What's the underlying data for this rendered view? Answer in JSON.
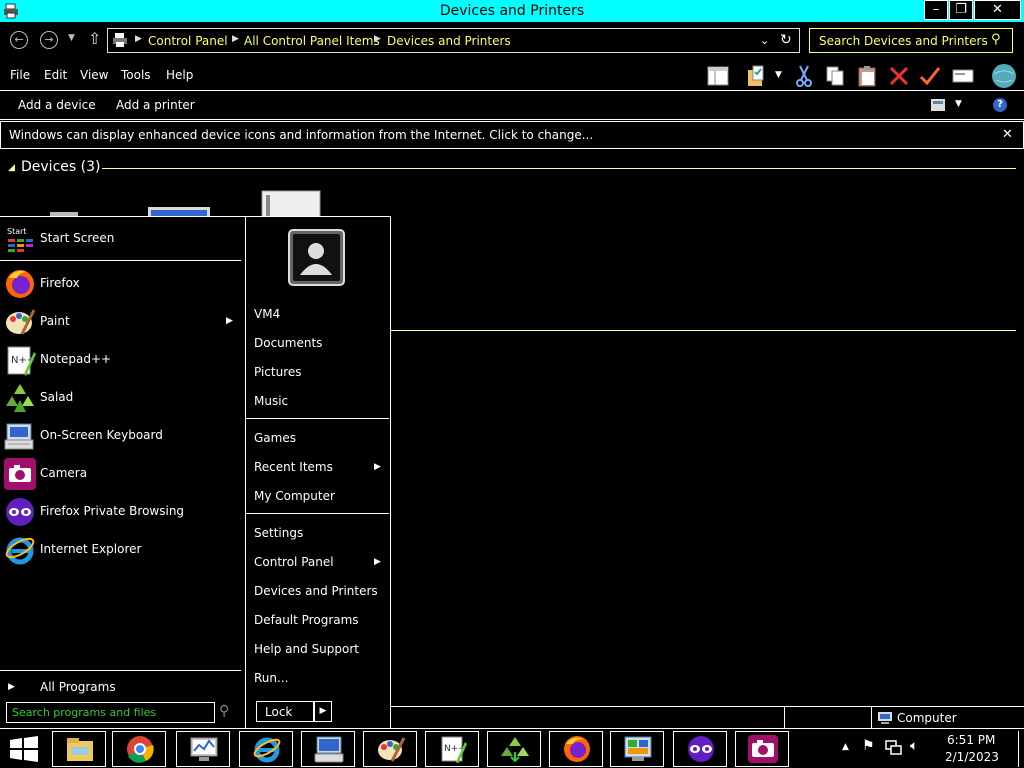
{
  "window": {
    "title": "Devices and Printers",
    "minimize_label": "–",
    "maximize_label": "❐",
    "close_label": "✕"
  },
  "address": {
    "crumbs": [
      "Control Panel",
      "All Control Panel Items",
      "Devices and Printers"
    ],
    "search_placeholder": "Search Devices and Printers"
  },
  "menubar": {
    "items": [
      "File",
      "Edit",
      "View",
      "Tools",
      "Help"
    ]
  },
  "commandbar": {
    "add_device": "Add a device",
    "add_printer": "Add a printer"
  },
  "infobar": {
    "text": "Windows can display enhanced device icons and information from the Internet. Click to change...",
    "close_label": "✕"
  },
  "groups": {
    "devices_header": "Devices (3)"
  },
  "startmenu": {
    "apps": [
      {
        "label": "Start Screen",
        "icon": "start-screen-icon"
      },
      {
        "label": "Firefox",
        "icon": "firefox-icon"
      },
      {
        "label": "Paint",
        "icon": "paint-icon"
      },
      {
        "label": "Notepad++",
        "icon": "notepad-plus-icon"
      },
      {
        "label": "Salad",
        "icon": "salad-icon"
      },
      {
        "label": "On-Screen Keyboard",
        "icon": "keyboard-icon"
      },
      {
        "label": "Camera",
        "icon": "camera-icon"
      },
      {
        "label": "Firefox Private Browsing",
        "icon": "private-browsing-icon"
      },
      {
        "label": "Internet Explorer",
        "icon": "ie-icon"
      }
    ],
    "start_icon_text": "Start",
    "all_programs": "All Programs",
    "search_placeholder": "Search programs and files",
    "right_items": {
      "user": "VM4",
      "documents": "Documents",
      "pictures": "Pictures",
      "music": "Music",
      "games": "Games",
      "recent_items": "Recent Items",
      "my_computer": "My Computer",
      "settings": "Settings",
      "control_panel": "Control Panel",
      "devices_printers": "Devices and Printers",
      "default_programs": "Default Programs",
      "help_support": "Help and Support",
      "run": "Run..."
    },
    "lock_label": "Lock"
  },
  "statusbar": {
    "computer_label": "Computer"
  },
  "taskbar": {
    "time": "6:51 PM",
    "date": "2/1/2023",
    "buttons": [
      "file-explorer-icon",
      "chrome-icon",
      "performance-monitor-icon",
      "ie-icon",
      "computer-icon",
      "paint-icon",
      "notepad-plus-icon",
      "salad-icon",
      "firefox-icon",
      "control-panel-icon",
      "private-browsing-icon",
      "camera-icon"
    ]
  },
  "colors": {
    "titlebar": "#00ffff",
    "accent_text": "#ffff66",
    "background": "#000000"
  }
}
